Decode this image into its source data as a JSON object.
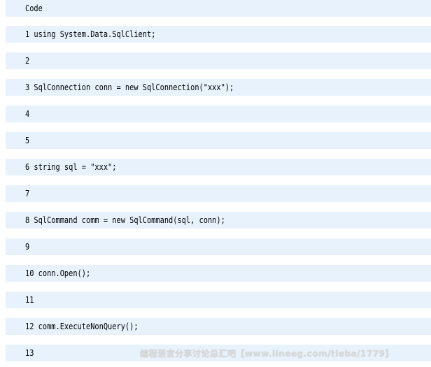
{
  "code_block": {
    "header_label": "Code",
    "lines": [
      "1 using System.Data.SqlClient;",
      "2",
      "3 SqlConnection conn = new SqlConnection(\"xxx\");",
      "4",
      "5",
      "6 string sql = \"xxx\";",
      "7",
      "8 SqlCommand comm = new SqlCommand(sql, conn);",
      "9",
      "10 conn.Open();",
      "11",
      "12 comm.ExecuteNonQuery();",
      "13"
    ]
  },
  "watermark": {
    "text": "编程语言分享讨论总汇吧【www.lineeg.com/tieba/1779】"
  },
  "colors": {
    "row_background": "#e8f2fc",
    "page_background": "#ffffff",
    "text": "#000000"
  }
}
